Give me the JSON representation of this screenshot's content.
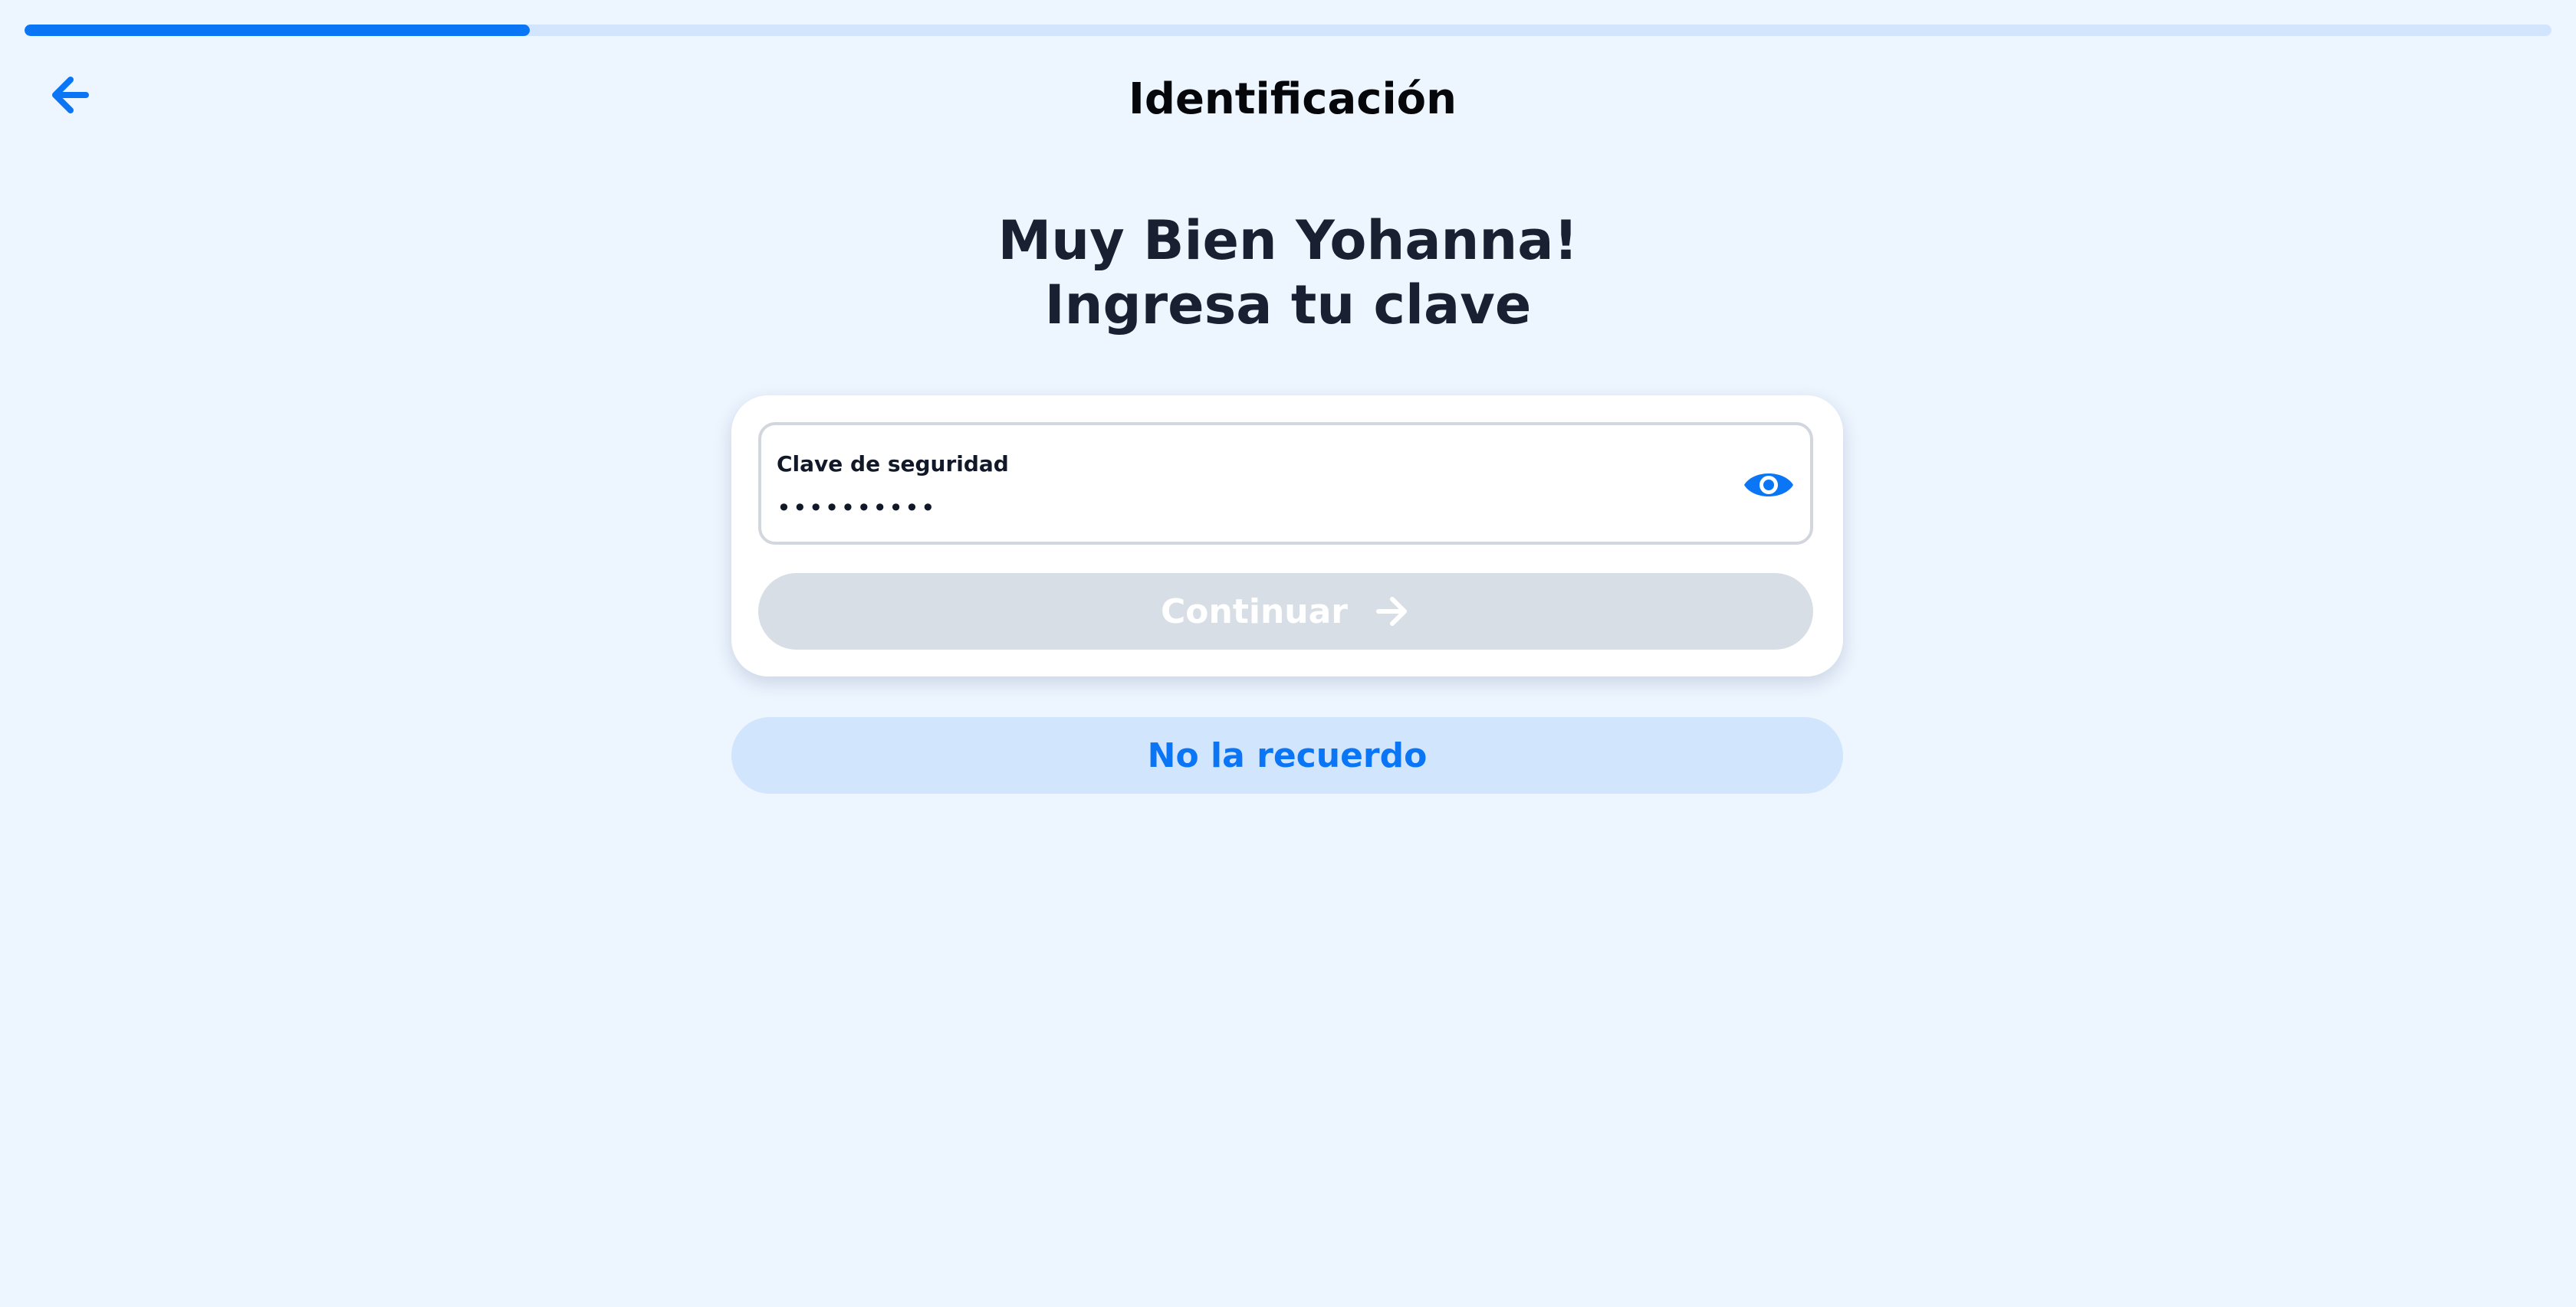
{
  "progress": {
    "fraction": 0.2
  },
  "header": {
    "title": "Identificación",
    "back_icon": "arrow-left-icon"
  },
  "main": {
    "heading_line1": "Muy Bien Yohanna!",
    "heading_line2": "Ingresa tu clave"
  },
  "password_field": {
    "label": "Clave de seguridad",
    "value": "••••••••••",
    "toggle_icon": "eye-icon"
  },
  "buttons": {
    "continue_label": "Continuar",
    "continue_icon": "arrow-right-icon",
    "forgot_label": "No la recuerdo"
  },
  "colors": {
    "accent": "#0a76f5",
    "background": "#edf5ff",
    "disabled_button": "#d8dee5",
    "secondary_button": "#d1e5fd"
  }
}
